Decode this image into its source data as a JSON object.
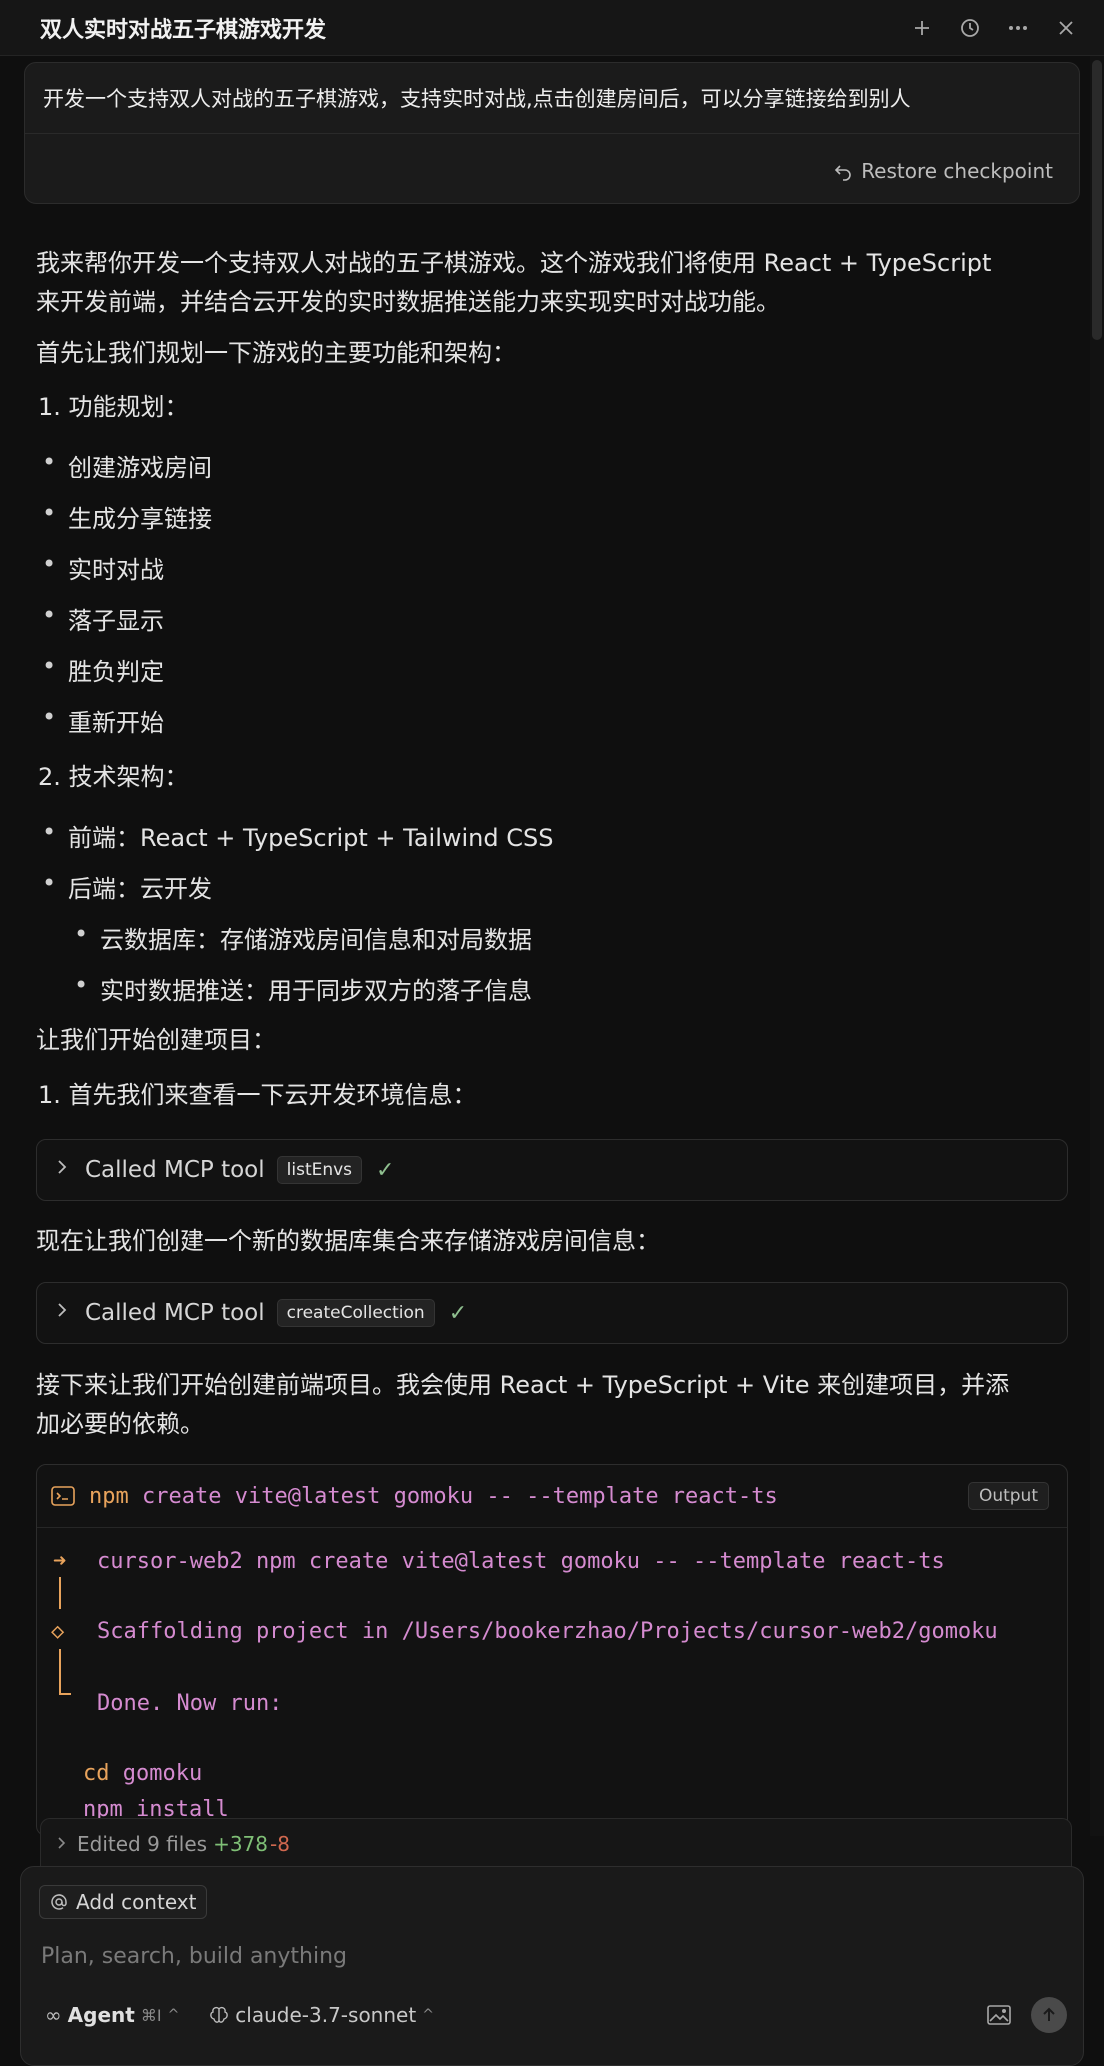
{
  "window": {
    "title": "双人实时对战五子棋游戏开发"
  },
  "user_message": {
    "text": "开发一个支持双人对战的五子棋游戏，支持实时对战,点击创建房间后，可以分享链接给到别人",
    "restore_label": "Restore checkpoint"
  },
  "assistant": {
    "intro_line1": "我来帮你开发一个支持双人对战的五子棋游戏。这个游戏我们将使用 React + TypeScript",
    "intro_line2": "来开发前端，并结合云开发的实时数据推送能力来实现实时对战功能。",
    "plan_intro": "首先让我们规划一下游戏的主要功能和架构：",
    "section1": "1. 功能规划：",
    "features": [
      "创建游戏房间",
      "生成分享链接",
      "实时对战",
      "落子显示",
      "胜负判定",
      "重新开始"
    ],
    "section2": "2. 技术架构：",
    "arch_frontend": "前端：React + TypeScript + Tailwind CSS",
    "arch_backend": "后端：云开发",
    "arch_backend_sub": [
      "云数据库：存储游戏房间信息和对局数据",
      "实时数据推送：用于同步双方的落子信息"
    ],
    "start_project": "让我们开始创建项目：",
    "step1": "1. 首先我们来查看一下云开发环境信息：",
    "collection_intro": "现在让我们创建一个新的数据库集合来存储游戏房间信息：",
    "frontend_line1": "接下来让我们开始创建前端项目。我会使用 React + TypeScript + Vite 来创建项目，并添",
    "frontend_line2": "加必要的依赖。"
  },
  "tool_calls": [
    {
      "label": "Called MCP tool",
      "tool": "listEnvs"
    },
    {
      "label": "Called MCP tool",
      "tool": "createCollection"
    }
  ],
  "terminal": {
    "cmd_prefix": "npm",
    "cmd_rest": "create vite@latest gomoku -- --template react-ts",
    "output_label": "Output",
    "arrow": "➜",
    "line1": "cursor-web2 npm create vite@latest gomoku -- --template react-ts",
    "diamond": "◇",
    "line2": "Scaffolding project in /Users/bookerzhao/Projects/cursor-web2/gomoku",
    "line3": "Done. Now run:",
    "cmd_cd": "cd",
    "cmd_cd_arg": "gomoku",
    "cmd_npm": "npm install"
  },
  "edited": {
    "label": "Edited 9 files",
    "added": "+378",
    "removed": "-8"
  },
  "composer": {
    "add_context": "Add context",
    "placeholder": "Plan, search, build anything",
    "mode": "Agent",
    "mode_shortcut": "⌘I",
    "model": "claude-3.7-sonnet"
  }
}
